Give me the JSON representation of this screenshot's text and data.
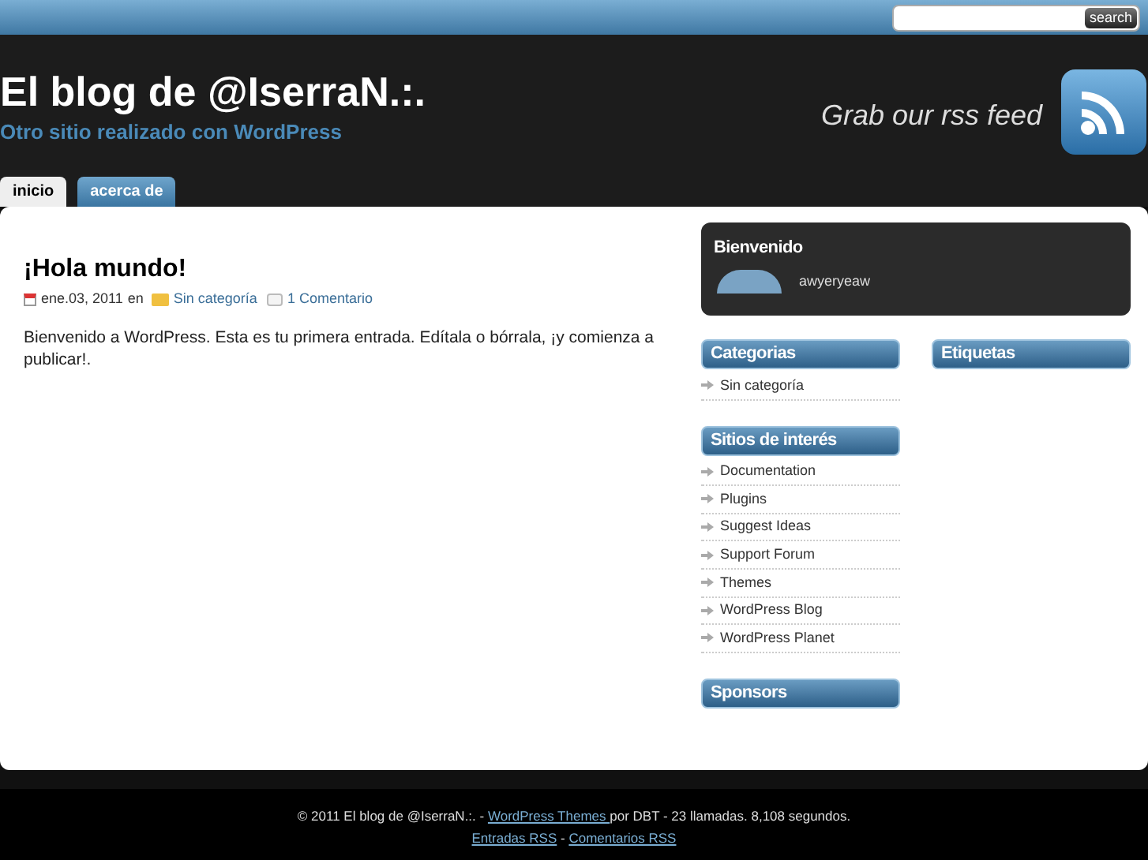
{
  "search": {
    "button": "search"
  },
  "header": {
    "title": "El blog de @IserraN.:.",
    "tagline": "Otro sitio realizado con WordPress",
    "rss_text": "Grab our rss feed"
  },
  "tabs": [
    {
      "label": "inicio",
      "selected": true
    },
    {
      "label": "acerca de",
      "selected": false
    }
  ],
  "post": {
    "title": "¡Hola mundo!",
    "date": "ene.03, 2011",
    "in": "en",
    "category": "Sin categoría",
    "comments": "1 Comentario",
    "body": "Bienvenido a WordPress. Esta es tu primera entrada. Edítala o bórrala, ¡y comienza a publicar!."
  },
  "welcome": {
    "title": "Bienvenido",
    "user": "awyeryeaw"
  },
  "widgets": [
    {
      "title": "Categorias",
      "items": [
        "Sin categoría"
      ]
    },
    {
      "title": "Sitios de interés",
      "items": [
        "Documentation",
        "Plugins",
        "Suggest Ideas",
        "Support Forum",
        "Themes",
        "WordPress Blog",
        "WordPress Planet"
      ]
    },
    {
      "title": "Sponsors"
    }
  ],
  "right_widgets": [
    {
      "title": "Etiquetas"
    }
  ],
  "footer": {
    "lines": [
      [
        {
          "kind": "text",
          "text": "© 2011 El blog de @IserraN.:. - "
        },
        {
          "kind": "link",
          "text": "WordPress Themes "
        },
        {
          "kind": "text",
          "text": "por DBT - 23 llamadas. 8,108 segundos."
        }
      ],
      [
        {
          "kind": "link",
          "text": "Entradas RSS"
        },
        {
          "kind": "text",
          "text": " - "
        },
        {
          "kind": "link",
          "text": "Comentarios RSS"
        }
      ]
    ]
  }
}
